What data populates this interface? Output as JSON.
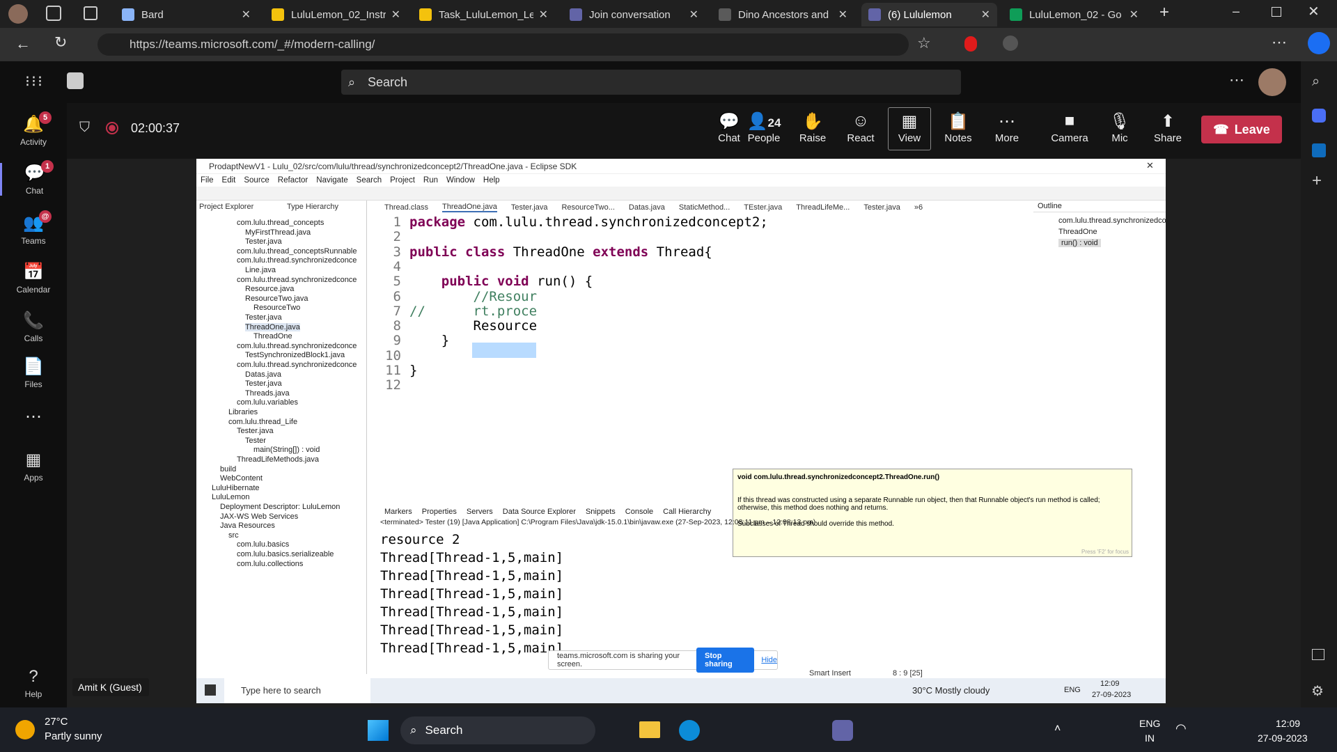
{
  "browser": {
    "tabs": [
      {
        "label": "Bard",
        "color": "#8ab4f8"
      },
      {
        "label": "LuluLemon_02_Instr",
        "color": "#f4c20d"
      },
      {
        "label": "Task_LuluLemon_Le",
        "color": "#f4c20d"
      },
      {
        "label": "Join conversation",
        "color": "#6264a7"
      },
      {
        "label": "Dino Ancestors and",
        "color": "#5a5a5a"
      },
      {
        "label": "(6) Lululemon",
        "color": "#6264a7"
      },
      {
        "label": "LuluLemon_02 - Go",
        "color": "#0f9d58"
      }
    ],
    "url": "https://teams.microsoft.com/_#/modern-calling/"
  },
  "teams": {
    "search_placeholder": "Search",
    "rail": [
      {
        "label": "Activity",
        "badge": "5"
      },
      {
        "label": "Chat",
        "badge": "1"
      },
      {
        "label": "Teams",
        "badge": "@"
      },
      {
        "label": "Calendar",
        "badge": ""
      },
      {
        "label": "Calls",
        "badge": ""
      },
      {
        "label": "Files",
        "badge": ""
      },
      {
        "label": "...",
        "badge": ""
      },
      {
        "label": "Apps",
        "badge": ""
      },
      {
        "label": "Help",
        "badge": ""
      }
    ],
    "timer": "02:00:37",
    "controls": [
      {
        "label": "Chat",
        "icon": "chat-icon",
        "count": ""
      },
      {
        "label": "People",
        "icon": "people-icon",
        "count": "24"
      },
      {
        "label": "Raise",
        "icon": "hand-icon",
        "count": ""
      },
      {
        "label": "React",
        "icon": "smile-icon",
        "count": ""
      },
      {
        "label": "View",
        "icon": "view-icon",
        "count": ""
      },
      {
        "label": "Notes",
        "icon": "notes-icon",
        "count": ""
      },
      {
        "label": "More",
        "icon": "more-icon",
        "count": ""
      },
      {
        "label": "Camera",
        "icon": "camera-icon",
        "count": ""
      },
      {
        "label": "Mic",
        "icon": "mic-off-icon",
        "count": ""
      },
      {
        "label": "Share",
        "icon": "share-icon",
        "count": ""
      }
    ],
    "leave_label": "Leave",
    "guest_name": "Amit K (Guest)"
  },
  "eclipse": {
    "title": "ProdaptNewV1 - Lulu_02/src/com/lulu/thread/synchronizedconcept2/ThreadOne.java - Eclipse SDK",
    "menu": [
      "File",
      "Edit",
      "Source",
      "Refactor",
      "Navigate",
      "Search",
      "Project",
      "Run",
      "Window",
      "Help"
    ],
    "left_tabs": [
      "Project Explorer",
      "Type Hierarchy"
    ],
    "tree": [
      {
        "t": "com.lulu.thread_concepts",
        "d": 3
      },
      {
        "t": "MyFirstThread.java",
        "d": 4
      },
      {
        "t": "Tester.java",
        "d": 4
      },
      {
        "t": "com.lulu.thread_conceptsRunnable",
        "d": 3
      },
      {
        "t": "com.lulu.thread.synchronizedconce",
        "d": 3
      },
      {
        "t": "Line.java",
        "d": 4
      },
      {
        "t": "com.lulu.thread.synchronizedconce",
        "d": 3
      },
      {
        "t": "Resource.java",
        "d": 4
      },
      {
        "t": "ResourceTwo.java",
        "d": 4
      },
      {
        "t": "ResourceTwo",
        "d": 5
      },
      {
        "t": "Tester.java",
        "d": 4
      },
      {
        "t": "ThreadOne.java",
        "d": 4
      },
      {
        "t": "ThreadOne",
        "d": 5
      },
      {
        "t": "com.lulu.thread.synchronizedconce",
        "d": 3
      },
      {
        "t": "TestSynchronizedBlock1.java",
        "d": 4
      },
      {
        "t": "com.lulu.thread.synchronizedconce",
        "d": 3
      },
      {
        "t": "Datas.java",
        "d": 4
      },
      {
        "t": "Tester.java",
        "d": 4
      },
      {
        "t": "Threads.java",
        "d": 4
      },
      {
        "t": "com.lulu.variables",
        "d": 3
      },
      {
        "t": "Libraries",
        "d": 2
      },
      {
        "t": "com.lulu.thread_Life",
        "d": 2
      },
      {
        "t": "Tester.java",
        "d": 3
      },
      {
        "t": "Tester",
        "d": 4
      },
      {
        "t": "main(String[]) : void",
        "d": 5
      },
      {
        "t": "ThreadLifeMethods.java",
        "d": 3
      },
      {
        "t": "build",
        "d": 1
      },
      {
        "t": "WebContent",
        "d": 1
      },
      {
        "t": "LuluHibernate",
        "d": 0
      },
      {
        "t": "LuluLemon",
        "d": 0
      },
      {
        "t": "Deployment Descriptor: LuluLemon",
        "d": 1
      },
      {
        "t": "JAX-WS Web Services",
        "d": 1
      },
      {
        "t": "Java Resources",
        "d": 1
      },
      {
        "t": "src",
        "d": 2
      },
      {
        "t": "com.lulu.basics",
        "d": 3
      },
      {
        "t": "com.lulu.basics.serializeable",
        "d": 3
      },
      {
        "t": "com.lulu.collections",
        "d": 3
      }
    ],
    "editor_tabs": [
      "Thread.class",
      "ThreadOne.java",
      "Tester.java",
      "ResourceTwo...",
      "Datas.java",
      "StaticMethod...",
      "TEster.java",
      "ThreadLifeMe...",
      "Tester.java",
      "»6"
    ],
    "code": [
      "package com.lulu.thread.synchronizedconcept2;",
      "",
      "public class ThreadOne extends Thread{",
      "",
      "    public void run() {",
      "        //Resour",
      "//      rt.proce",
      "        Resource",
      "    }",
      "",
      "}",
      ""
    ],
    "tooltip": {
      "header": "void com.lulu.thread.synchronizedconcept2.ThreadOne.run()",
      "body1": "If this thread was constructed using a separate Runnable run object, then that Runnable object's run method is called; otherwise, this method does nothing and returns.",
      "body2": "Subclasses of Thread should override this method.",
      "footer": "Press 'F2' for focus"
    },
    "outline": {
      "tab": "Outline",
      "pkg": "com.lulu.thread.synchronizedco",
      "cls": "ThreadOne",
      "method": "run() : void"
    },
    "console_tabs": [
      "Markers",
      "Properties",
      "Servers",
      "Data Source Explorer",
      "Snippets",
      "Console",
      "Call Hierarchy"
    ],
    "console_info": "<terminated> Tester (19) [Java Application] C:\\Program Files\\Java\\jdk-15.0.1\\bin\\javaw.exe (27-Sep-2023, 12:08:11 pm – 12:08:13 pm)",
    "console_lines": [
      "resource 2",
      "Thread[Thread-1,5,main]",
      "Thread[Thread-1,5,main]",
      "Thread[Thread-1,5,main]",
      "Thread[Thread-1,5,main]",
      "Thread[Thread-1,5,main]",
      "Thread[Thread-1,5,main]"
    ],
    "sharing": {
      "text": "teams.microsoft.com is sharing your screen.",
      "stop": "Stop sharing",
      "hide": "Hide"
    },
    "status": {
      "mode": "Smart Insert",
      "pos": "8 : 9 [25]"
    },
    "inner_taskbar": {
      "search": "Type here to search",
      "weather": "30°C  Mostly cloudy",
      "lang": "ENG",
      "time": "12:09",
      "date": "27-09-2023"
    }
  },
  "taskbar": {
    "weather_temp": "27°C",
    "weather_desc": "Partly sunny",
    "search": "Search",
    "lang1": "ENG",
    "lang2": "IN",
    "time": "12:09",
    "date": "27-09-2023"
  }
}
